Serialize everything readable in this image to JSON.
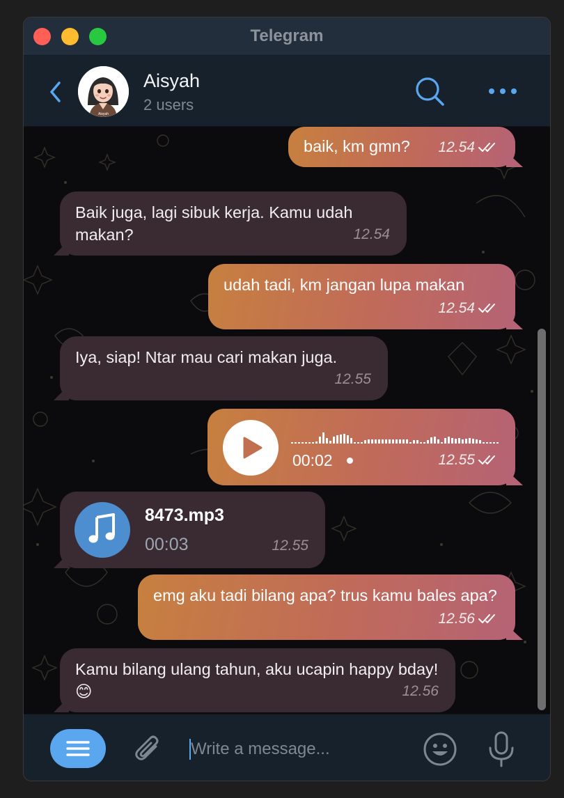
{
  "window": {
    "title": "Telegram"
  },
  "header": {
    "name": "Aisyah",
    "subtitle": "2 users",
    "avatar_caption": "Aisyah",
    "icons": {
      "back": "chevron-left-icon",
      "search": "search-icon",
      "more": "more-dots-icon"
    }
  },
  "messages": [
    {
      "direction": "out",
      "type": "text",
      "text": "baik, km gmn?",
      "time": "12.54",
      "status": "read"
    },
    {
      "direction": "in",
      "type": "text",
      "text": "Baik juga, lagi sibuk kerja. Kamu udah makan?",
      "time": "12.54"
    },
    {
      "direction": "out",
      "type": "text",
      "text": "udah tadi, km jangan lupa makan",
      "time": "12.54",
      "status": "read"
    },
    {
      "direction": "in",
      "type": "text",
      "text": "Iya, siap! Ntar mau cari makan juga.",
      "time": "12.55"
    },
    {
      "direction": "out",
      "type": "voice",
      "duration": "00:02",
      "time": "12.55",
      "status": "read"
    },
    {
      "direction": "in",
      "type": "file",
      "file_name": "8473.mp3",
      "duration": "00:03",
      "time": "12.55"
    },
    {
      "direction": "out",
      "type": "text",
      "text": "emg aku tadi bilang apa? trus kamu bales apa?",
      "time": "12.56",
      "status": "read"
    },
    {
      "direction": "in",
      "type": "text",
      "text": "Kamu bilang ulang tahun, aku ucapin happy bday! 😊",
      "time": "12.56"
    }
  ],
  "composer": {
    "placeholder": "Write a message...",
    "value": "",
    "icons": {
      "menu": "menu-icon",
      "attach": "paperclip-icon",
      "emoji": "emoji-icon",
      "mic": "microphone-icon"
    }
  },
  "colors": {
    "accent": "#5aa7f0",
    "incoming_bubble": "#3a2a32",
    "outgoing_gradient": [
      "#c7803f",
      "#c06a5a",
      "#b56375"
    ],
    "header_bg": "#17212b"
  }
}
